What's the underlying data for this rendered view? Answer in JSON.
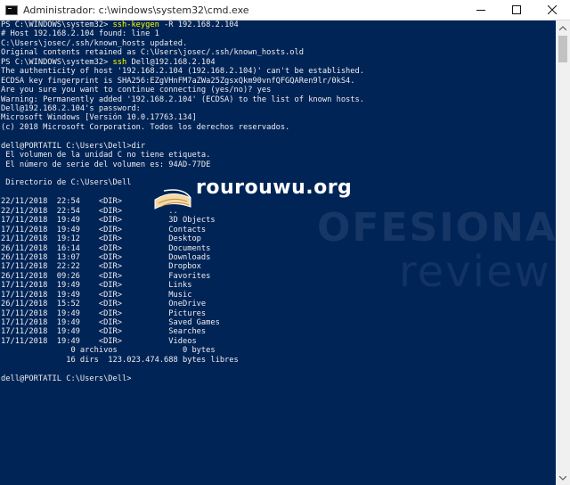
{
  "window": {
    "title": "Administrador: c:\\windows\\system32\\cmd.exe",
    "icon": "cmd-icon",
    "controls": {
      "minimize": "minimize-icon",
      "maximize": "maximize-icon",
      "close": "close-icon"
    }
  },
  "colors": {
    "background": "#012456",
    "text": "#eeedf0",
    "command": "#ffff00",
    "titlebar": "#ffffff",
    "scrollbar": "#f0f0f0"
  },
  "console": {
    "lines": [
      {
        "text": "PS C:\\WINDOWS\\system32> ",
        "cmd": "ssh-keygen",
        "rest": " -R 192.168.2.104"
      },
      {
        "text": "# Host 192.168.2.104 found: line 1"
      },
      {
        "text": "C:\\Users\\josec/.ssh/known_hosts updated."
      },
      {
        "text": "Original contents retained as C:\\Users\\josec/.ssh/known_hosts.old"
      },
      {
        "text": "PS C:\\WINDOWS\\system32> ",
        "cmd": "ssh",
        "rest": " Dell@192.168.2.104"
      },
      {
        "text": "The authenticity of host '192.168.2.104 (192.168.2.104)' can't be established."
      },
      {
        "text": "ECDSA key fingerprint is SHA256:EZgVHnFM7aZWa25ZgsxQkm90vnfQFGQARen9lr/0kS4."
      },
      {
        "text": "Are you sure you want to continue connecting (yes/no)? yes"
      },
      {
        "text": "Warning: Permanently added '192.168.2.104' (ECDSA) to the list of known hosts."
      },
      {
        "text": "Dell@192.168.2.104's password:"
      },
      {
        "text": "Microsoft Windows [Versión 10.0.17763.134]"
      },
      {
        "text": "(c) 2018 Microsoft Corporation. Todos los derechos reservados."
      },
      {
        "text": ""
      },
      {
        "text": "dell@PORTATIL C:\\Users\\Dell>dir"
      },
      {
        "text": " El volumen de la unidad C no tiene etiqueta."
      },
      {
        "text": " El número de serie del volumen es: 94AD-77DE"
      },
      {
        "text": ""
      },
      {
        "text": " Directorio de C:\\Users\\Dell"
      },
      {
        "text": ""
      },
      {
        "text": "22/11/2018  22:54    <DIR>          ."
      },
      {
        "text": "22/11/2018  22:54    <DIR>          .."
      },
      {
        "text": "17/11/2018  19:49    <DIR>          3D Objects"
      },
      {
        "text": "17/11/2018  19:49    <DIR>          Contacts"
      },
      {
        "text": "21/11/2018  19:12    <DIR>          Desktop"
      },
      {
        "text": "26/11/2018  16:14    <DIR>          Documents"
      },
      {
        "text": "26/11/2018  13:07    <DIR>          Downloads"
      },
      {
        "text": "17/11/2018  22:22    <DIR>          Dropbox"
      },
      {
        "text": "26/11/2018  09:26    <DIR>          Favorites"
      },
      {
        "text": "17/11/2018  19:49    <DIR>          Links"
      },
      {
        "text": "17/11/2018  19:49    <DIR>          Music"
      },
      {
        "text": "26/11/2018  15:52    <DIR>          OneDrive"
      },
      {
        "text": "17/11/2018  19:49    <DIR>          Pictures"
      },
      {
        "text": "17/11/2018  19:49    <DIR>          Saved Games"
      },
      {
        "text": "17/11/2018  19:49    <DIR>          Searches"
      },
      {
        "text": "17/11/2018  19:49    <DIR>          Videos"
      },
      {
        "text": "               0 archivos              0 bytes"
      },
      {
        "text": "              16 dirs  123.023.474.688 bytes libres"
      },
      {
        "text": ""
      },
      {
        "text": "dell@PORTATIL C:\\Users\\Dell>"
      }
    ]
  },
  "watermark": {
    "logo_text": "rourouwu.org",
    "logo_icon": "open-book-icon",
    "background_text": "OFESIONAL",
    "background_sub": "review"
  }
}
